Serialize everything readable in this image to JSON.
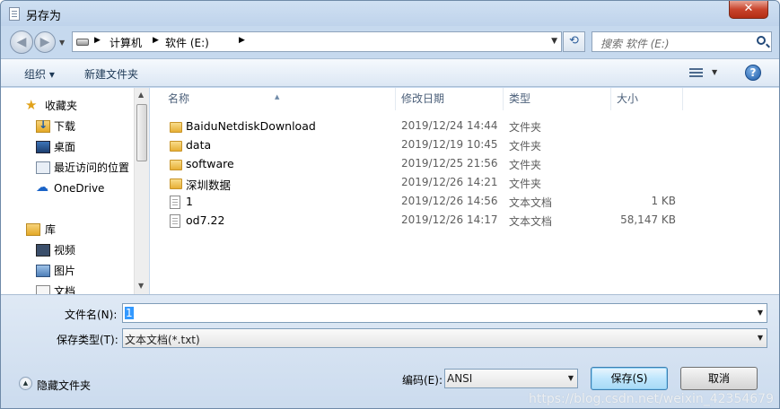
{
  "window": {
    "title": "另存为",
    "close_label": "✕"
  },
  "nav": {
    "breadcrumb": [
      "计算机",
      "软件 (E:)"
    ],
    "search_placeholder": "搜索 软件 (E:)"
  },
  "toolbar": {
    "organize": "组织 ▾",
    "new_folder": "新建文件夹"
  },
  "sidebar": {
    "items": [
      {
        "label": "收藏夹",
        "icon": "star-icon"
      },
      {
        "label": "下载",
        "icon": "download-folder-icon"
      },
      {
        "label": "桌面",
        "icon": "desktop-icon"
      },
      {
        "label": "最近访问的位置",
        "icon": "recent-places-icon"
      },
      {
        "label": "OneDrive",
        "icon": "cloud-icon"
      },
      {
        "label": "库",
        "icon": "library-icon"
      },
      {
        "label": "视频",
        "icon": "video-icon"
      },
      {
        "label": "图片",
        "icon": "picture-icon"
      },
      {
        "label": "文档",
        "icon": "document-icon"
      }
    ]
  },
  "columns": {
    "name": "名称",
    "date": "修改日期",
    "type": "类型",
    "size": "大小"
  },
  "files": [
    {
      "name": "BaiduNetdiskDownload",
      "date": "2019/12/24 14:44",
      "type": "文件夹",
      "size": "",
      "kind": "folder"
    },
    {
      "name": "data",
      "date": "2019/12/19 10:45",
      "type": "文件夹",
      "size": "",
      "kind": "folder"
    },
    {
      "name": "software",
      "date": "2019/12/25 21:56",
      "type": "文件夹",
      "size": "",
      "kind": "folder"
    },
    {
      "name": "深圳数据",
      "date": "2019/12/26 14:21",
      "type": "文件夹",
      "size": "",
      "kind": "folder"
    },
    {
      "name": "1",
      "date": "2019/12/26 14:56",
      "type": "文本文档",
      "size": "1 KB",
      "kind": "txt"
    },
    {
      "name": "od7.22",
      "date": "2019/12/26 14:17",
      "type": "文本文档",
      "size": "58,147 KB",
      "kind": "txt"
    }
  ],
  "form": {
    "filename_label": "文件名(N):",
    "filename_value": "1",
    "filetype_label": "保存类型(T):",
    "filetype_value": "文本文档(*.txt)",
    "encoding_label": "编码(E):",
    "encoding_value": "ANSI",
    "save": "保存(S)",
    "cancel": "取消",
    "hide_folders": "隐藏文件夹"
  },
  "watermark": "https://blog.csdn.net/weixin_42354679"
}
